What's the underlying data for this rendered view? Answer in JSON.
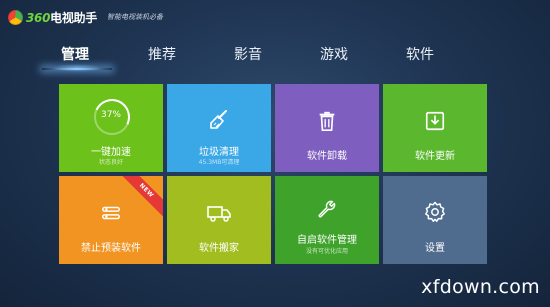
{
  "app": {
    "logo_number": "360",
    "logo_name": "电视助手",
    "slogan": "智能电视装机必备"
  },
  "tabs": [
    {
      "label": "管理",
      "active": true
    },
    {
      "label": "推荐",
      "active": false
    },
    {
      "label": "影音",
      "active": false
    },
    {
      "label": "游戏",
      "active": false
    },
    {
      "label": "软件",
      "active": false
    }
  ],
  "tiles": {
    "speedup": {
      "label": "一键加速",
      "sub": "状态良好",
      "percent": "37%",
      "color": "#6cc11b"
    },
    "cleanup": {
      "label": "垃圾清理",
      "sub": "45.3MB可清理",
      "color": "#3aa7e6",
      "icon": "broom-icon"
    },
    "uninstall": {
      "label": "软件卸载",
      "color": "#7e5fbf",
      "icon": "trash-icon"
    },
    "update": {
      "label": "软件更新",
      "color": "#5bb82e",
      "icon": "download-tray-icon"
    },
    "preinstall": {
      "label": "禁止预装软件",
      "badge": "NEW",
      "color": "#f19422",
      "icon": "toggle-list-icon"
    },
    "move": {
      "label": "软件搬家",
      "color": "#a2bd1f",
      "icon": "truck-icon"
    },
    "autostart": {
      "label": "自启软件管理",
      "sub": "没有可优化应用",
      "color": "#3fa32b",
      "icon": "wrench-icon"
    },
    "settings": {
      "label": "设置",
      "color": "#4f6b8e",
      "icon": "gear-icon"
    }
  },
  "watermark": "xfdown.com"
}
